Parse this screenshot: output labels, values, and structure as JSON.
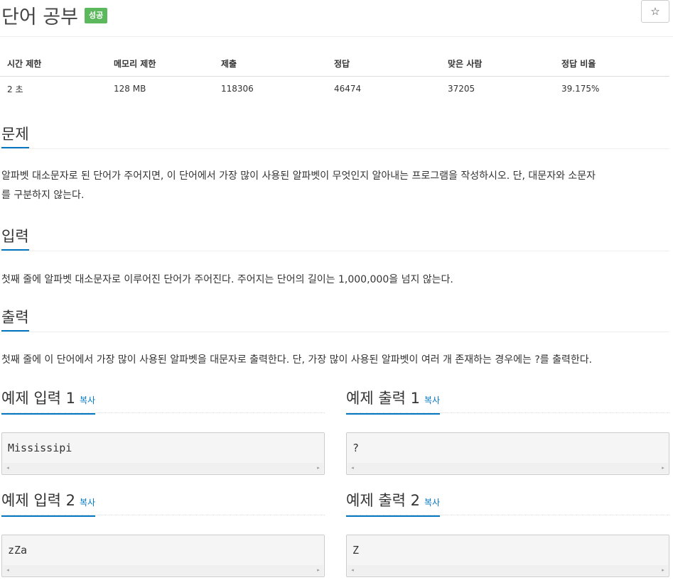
{
  "header": {
    "title": "단어 공부",
    "badge": "성공",
    "star": "☆"
  },
  "info_table": {
    "headers": [
      "시간 제한",
      "메모리 제한",
      "제출",
      "정답",
      "맞은 사람",
      "정답 비율"
    ],
    "values": [
      "2 초",
      "128 MB",
      "118306",
      "46474",
      "37205",
      "39.175%"
    ]
  },
  "problem": {
    "heading": "문제",
    "text_line1": "알파벳 대소문자로 된 단어가 주어지면, 이 단어에서 가장 많이 사용된 알파벳이 무엇인지 알아내는 프로그램을 작성하시오. 단, 대문자와 소문자",
    "text_line2": "를 구분하지 않는다."
  },
  "input": {
    "heading": "입력",
    "text": "첫째 줄에 알파벳 대소문자로 이루어진 단어가 주어진다. 주어지는 단어의 길이는 1,000,000을 넘지 않는다."
  },
  "output": {
    "heading": "출력",
    "text": "첫째 줄에 이 단어에서 가장 많이 사용된 알파벳을 대문자로 출력한다. 단, 가장 많이 사용된 알파벳이 여러 개 존재하는 경우에는 ?를 출력한다."
  },
  "samples": {
    "copy_label": "복사",
    "in1_title": "예제 입력 1",
    "out1_title": "예제 출력 1",
    "in2_title": "예제 입력 2",
    "out2_title": "예제 출력 2",
    "in1": "Mississipi",
    "out1": "?",
    "in2": "zZa",
    "out2": "Z"
  },
  "icons": {
    "scroll_left": "◂",
    "scroll_right": "▸"
  }
}
